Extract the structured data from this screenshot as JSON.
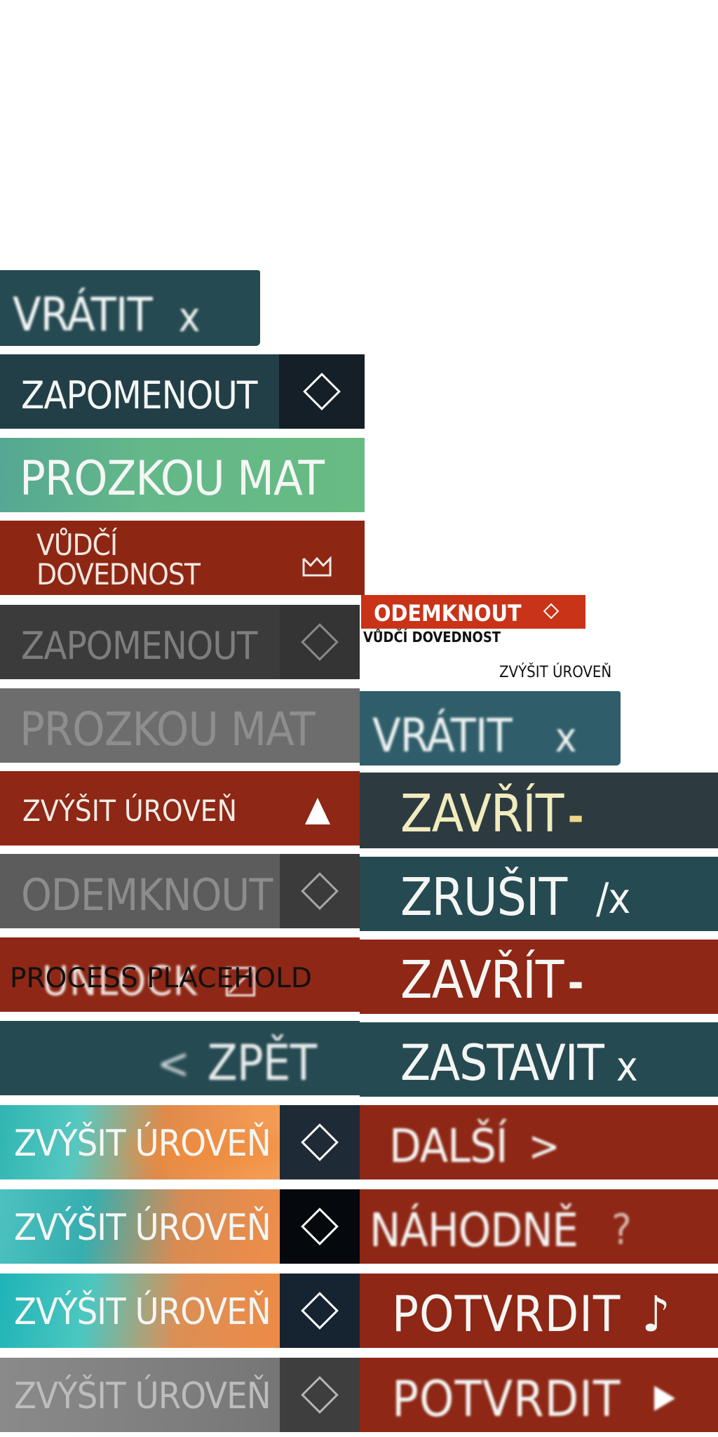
{
  "left_buttons": {
    "vratit": {
      "label": "VRÁTIT",
      "icon": "x"
    },
    "zapomenout": {
      "label": "ZAPOMENOUT",
      "icon": "diamond-icon"
    },
    "prozkoumat": {
      "label": "PROZKOU MAT"
    },
    "vudci_dovednost": {
      "line1": "VŮDČÍ",
      "line2": "DOVEDNOST",
      "icon": "crown-icon"
    },
    "zapomenout_disabled": {
      "label": "ZAPOMENOUT",
      "icon": "diamond-icon"
    },
    "prozkoumat_disabled": {
      "label": "PROZKOU MAT"
    },
    "zvysit_uroven": {
      "label": "ZVÝŠIT ÚROVEŇ",
      "icon": "triangle-up-icon"
    },
    "odemknout_disabled": {
      "label": "ODEMKNOUT",
      "icon": "diamond-icon"
    },
    "unlock": {
      "label": "UNLOCK",
      "overlay": "PROCESS PLACEHOLD",
      "icon": "checkbox-icon"
    },
    "zpet": {
      "arrow": "<",
      "label": "ZPĚT"
    },
    "zvysit_gradients": [
      {
        "label": "ZVÝŠIT ÚROVEŇ"
      },
      {
        "label": "ZVÝŠIT ÚROVEŇ"
      },
      {
        "label": "ZVÝŠIT ÚROVEŇ"
      },
      {
        "label": "ZVÝŠIT ÚROVEŇ"
      }
    ]
  },
  "right_buttons": {
    "odemknout_small": {
      "label": "ODEMKNOUT",
      "subtitle": "VŮDČÍ DOVEDNOST",
      "icon": "diamond-icon"
    },
    "zvysit_text": "ZVÝŠIT ÚROVEŇ",
    "vratit": {
      "label": "VRÁTIT",
      "icon": "x"
    },
    "zavrit_dark": {
      "label": "ZAVŘÍT",
      "icon": "-"
    },
    "zrusit": {
      "label": "ZRUŠIT",
      "icon": "/x"
    },
    "zavrit_red": {
      "label": "ZAVŘÍT",
      "icon": "-"
    },
    "zastavit": {
      "label": "ZASTAVIT",
      "icon": "x"
    },
    "dalsi": {
      "label": "DALŠÍ",
      "icon": ">"
    },
    "nahodne": {
      "label": "NÁHODNĚ",
      "icon": "?"
    },
    "potvrdit_music": {
      "label": "POTVRDIT",
      "icon": "♪"
    },
    "potvrdit_play": {
      "label": "POTVRDIT",
      "icon": "play-icon"
    }
  },
  "colors": {
    "teal_dark": "#264a52",
    "red": "#8e2715",
    "green": "#63b487",
    "dark_gray": "#3b3b3b",
    "mid_gray": "#6d6d6d",
    "navy": "#192730",
    "orange_red": "#c93318"
  }
}
